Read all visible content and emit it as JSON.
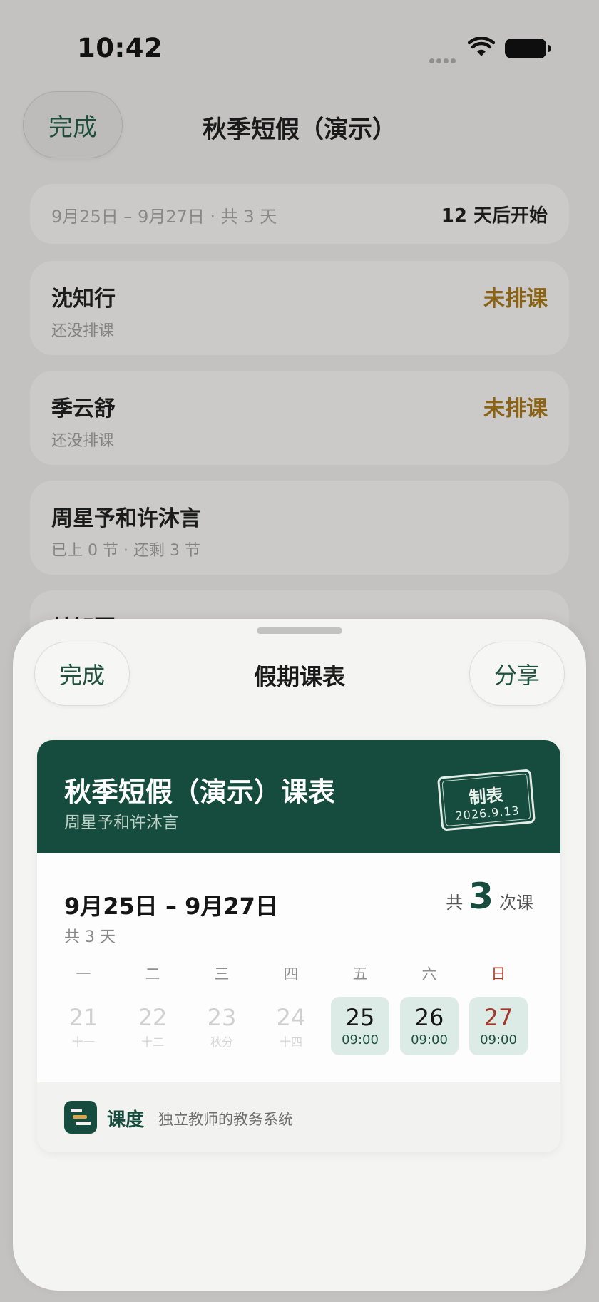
{
  "status_bar": {
    "time": "10:42"
  },
  "header": {
    "done_label": "完成",
    "title": "秋季短假（演示）"
  },
  "summary": {
    "range": "9月25日 – 9月27日 · 共 3 天",
    "start_in": "12 天后开始"
  },
  "students": [
    {
      "name": "沈知行",
      "sub": "还没排课",
      "status": "未排课"
    },
    {
      "name": "季云舒",
      "sub": "还没排课",
      "status": "未排课"
    },
    {
      "name": "周星予和许沐言",
      "sub": "已上 0 节 · 还剩 3 节",
      "status": ""
    },
    {
      "name": "林知夏",
      "sub": "",
      "status": ""
    }
  ],
  "sheet": {
    "done_label": "完成",
    "title": "假期课表",
    "share_label": "分享",
    "card": {
      "title": "秋季短假（演示）课表",
      "subtitle": "周星予和许沐言",
      "stamp_label": "制表",
      "stamp_date": "2026.9.13",
      "date_range": "9月25日 – 9月27日",
      "day_count": "共 3 天",
      "lessons_prefix": "共",
      "lessons_count": "3",
      "lessons_suffix": "次课",
      "weekdays": [
        "一",
        "二",
        "三",
        "四",
        "五",
        "六",
        "日"
      ],
      "days": [
        {
          "num": "21",
          "note": "十一",
          "active": false
        },
        {
          "num": "22",
          "note": "十二",
          "active": false
        },
        {
          "num": "23",
          "note": "秋分",
          "active": false
        },
        {
          "num": "24",
          "note": "十四",
          "active": false
        },
        {
          "num": "25",
          "note": "09:00",
          "active": true
        },
        {
          "num": "26",
          "note": "09:00",
          "active": true
        },
        {
          "num": "27",
          "note": "09:00",
          "active": true
        }
      ],
      "footer": {
        "app_name": "课度",
        "tagline": "独立教师的教务系统"
      }
    }
  },
  "colors": {
    "brand_green": "#164c3d",
    "warning_brown": "#8b6316",
    "sunday_red": "#a0392b",
    "active_day_bg": "#dcebe6"
  }
}
